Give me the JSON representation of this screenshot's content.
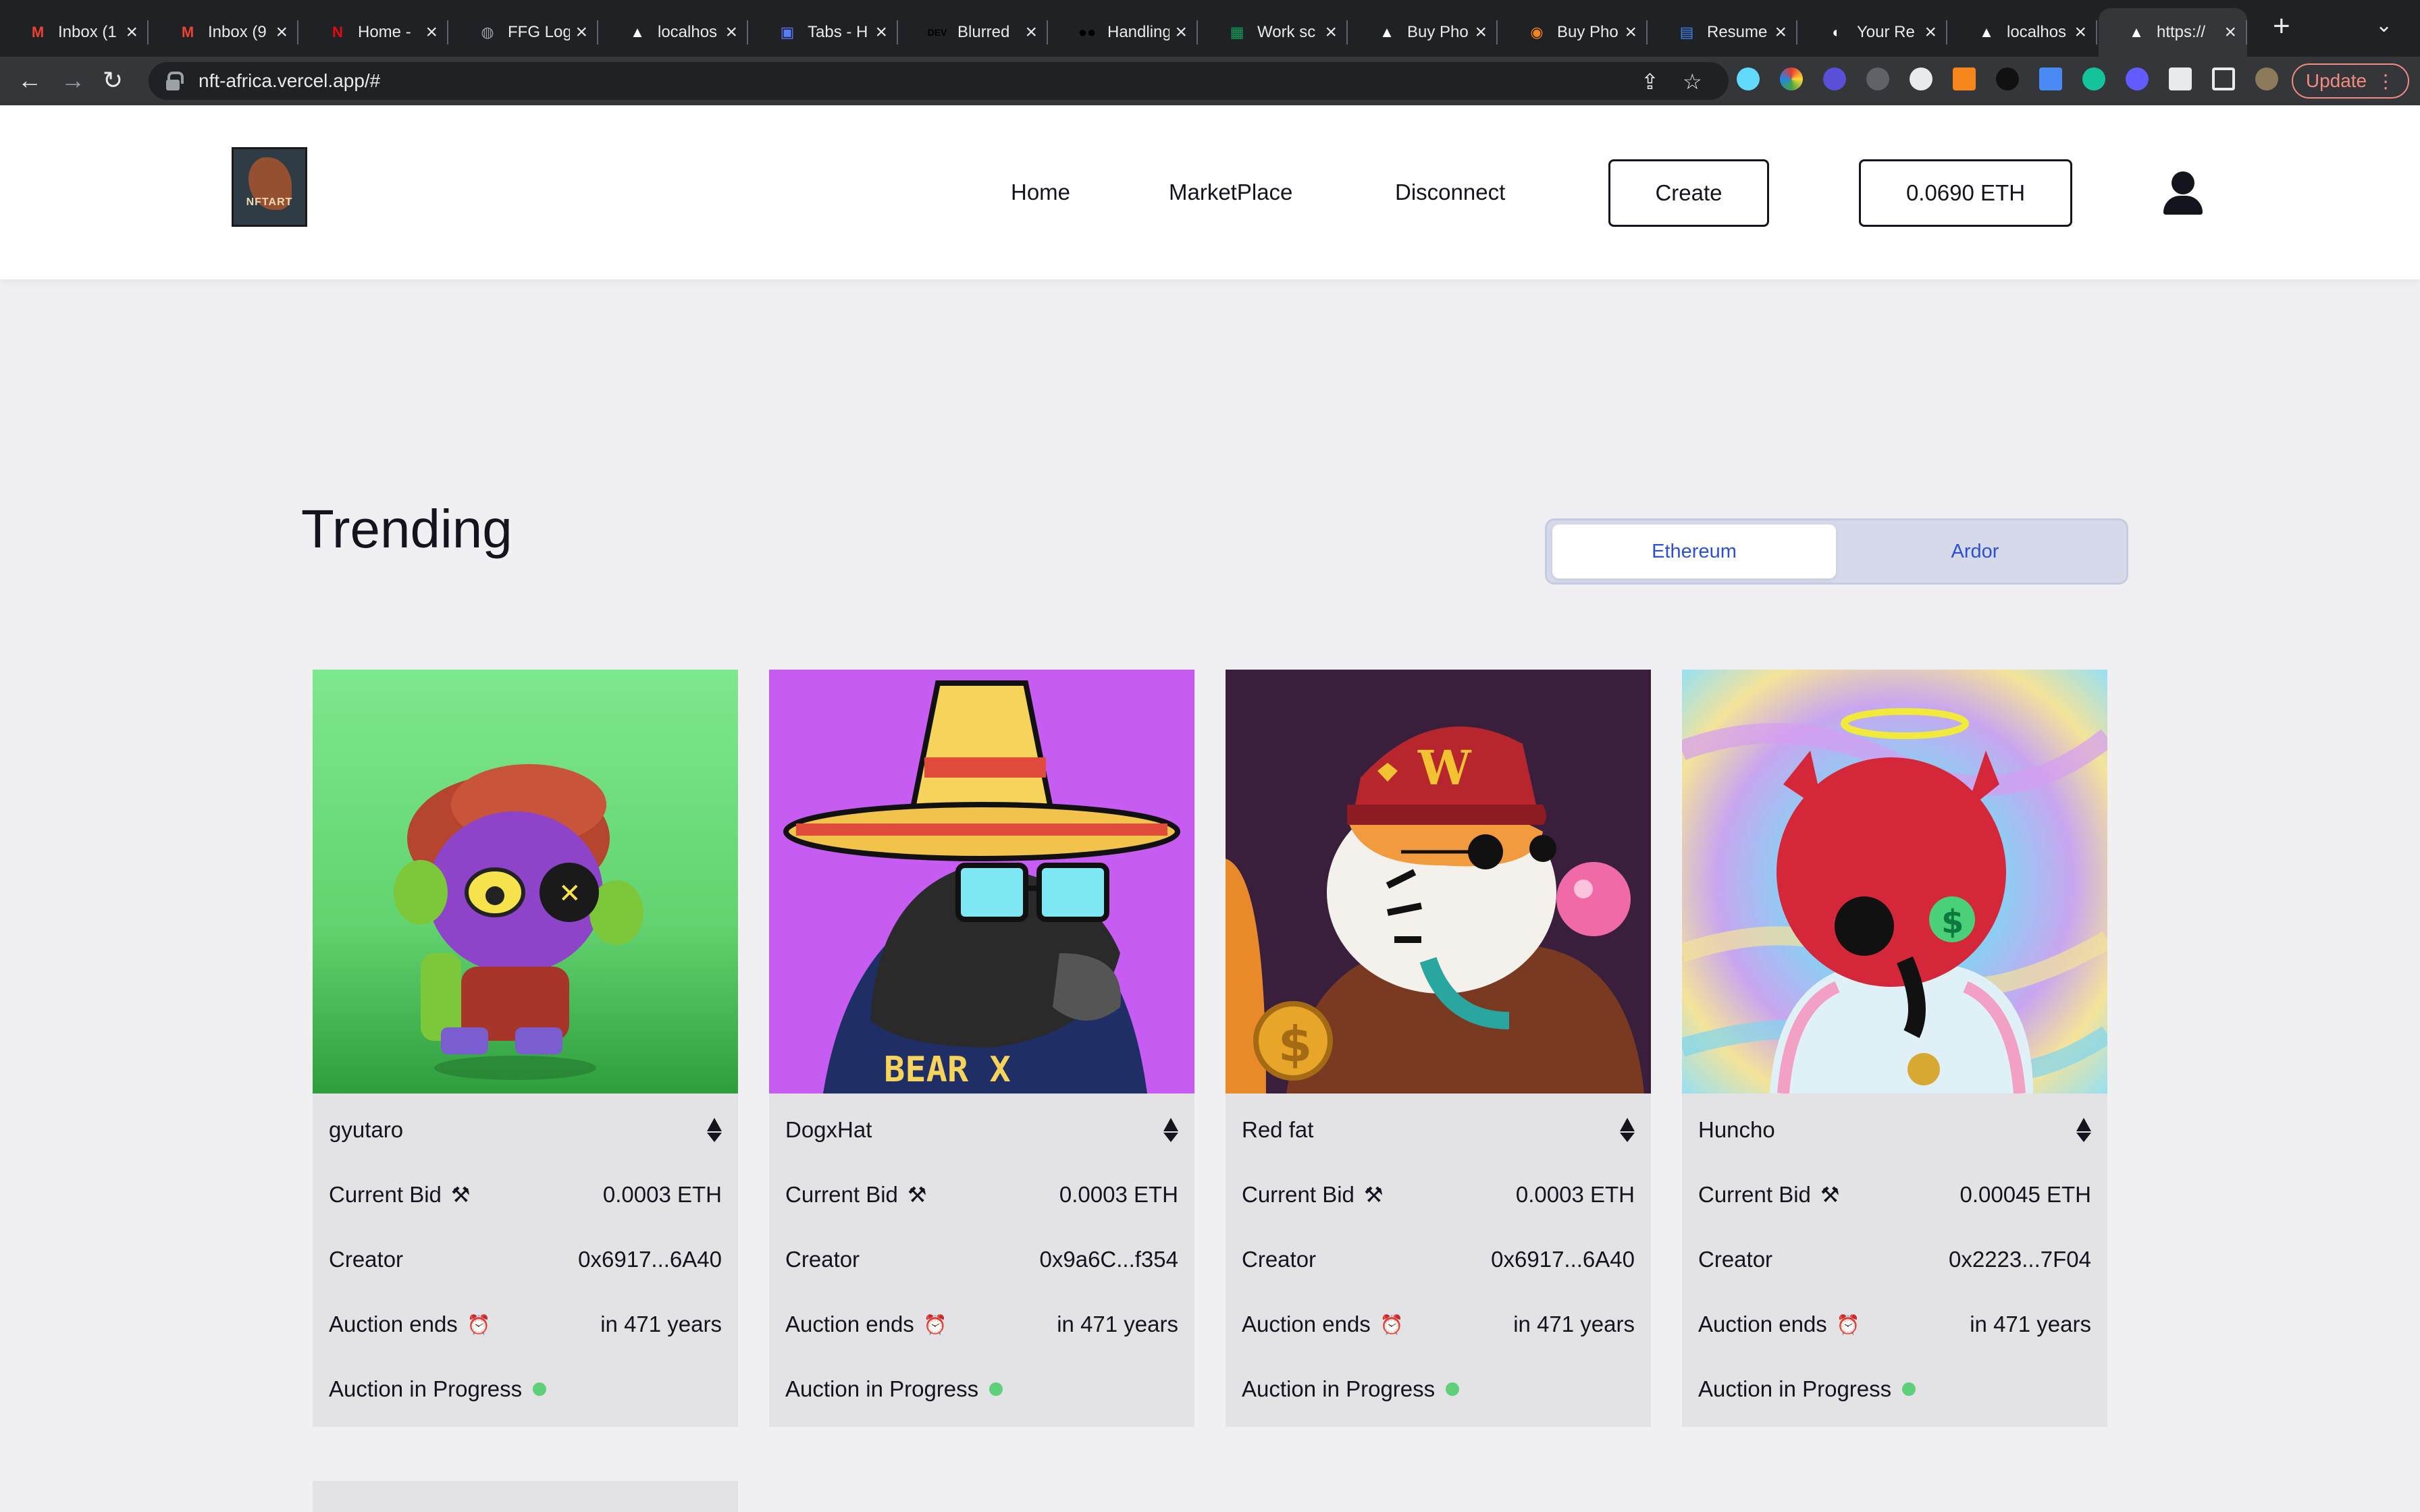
{
  "browser": {
    "tabs": [
      {
        "label": "Inbox (1",
        "favicon": "gmail-icon",
        "color": "#ea4335",
        "glyph": "M"
      },
      {
        "label": "Inbox (9",
        "favicon": "gmail-icon",
        "color": "#ea4335",
        "glyph": "M"
      },
      {
        "label": "Home -",
        "favicon": "netflix-icon",
        "color": "#e50914",
        "glyph": "N"
      },
      {
        "label": "FFG Log",
        "favicon": "globe-icon",
        "color": "#9aa0a6",
        "glyph": "◍"
      },
      {
        "label": "localhos",
        "favicon": "vercel-icon",
        "color": "#ffffff",
        "glyph": "▲"
      },
      {
        "label": "Tabs - H",
        "favicon": "app-icon",
        "color": "#5b7cfa",
        "glyph": "▣"
      },
      {
        "label": "Blurred",
        "favicon": "dev-icon",
        "color": "#000000",
        "glyph": "DEV"
      },
      {
        "label": "Handling",
        "favicon": "medium-icon",
        "color": "#000000",
        "glyph": "●●"
      },
      {
        "label": "Work sc",
        "favicon": "sheets-icon",
        "color": "#0f9d58",
        "glyph": "▦"
      },
      {
        "label": "Buy Pho",
        "favicon": "vercel-icon",
        "color": "#ffffff",
        "glyph": "▲"
      },
      {
        "label": "Buy Pho",
        "favicon": "coin-icon",
        "color": "#f6851b",
        "glyph": "◉"
      },
      {
        "label": "Resume",
        "favicon": "doc-icon",
        "color": "#4285f4",
        "glyph": "▤"
      },
      {
        "label": "Your Re",
        "favicon": "github-icon",
        "color": "#ffffff",
        "glyph": "◐"
      },
      {
        "label": "localhos",
        "favicon": "vercel-icon",
        "color": "#ffffff",
        "glyph": "▲"
      },
      {
        "label": "https://",
        "favicon": "vercel-icon",
        "color": "#ffffff",
        "glyph": "▲"
      }
    ],
    "url": "nft-africa.vercel.app/#",
    "update_label": "Update"
  },
  "header": {
    "logo_text": "NFTART",
    "nav": {
      "home": "Home",
      "marketplace": "MarketPlace",
      "disconnect": "Disconnect"
    },
    "create_label": "Create",
    "balance": "0.0690 ETH"
  },
  "trending": {
    "title": "Trending",
    "chains": [
      "Ethereum",
      "Ardor"
    ],
    "active_chain": "Ethereum"
  },
  "labels": {
    "current_bid": "Current Bid",
    "creator": "Creator",
    "auction_ends": "Auction ends",
    "status": "Auction in Progress"
  },
  "cards": [
    {
      "name": "gyutaro",
      "bid": "0.0003 ETH",
      "creator": "0x6917...6A40",
      "ends": "in 471 years",
      "bg": "#7be08a"
    },
    {
      "name": "DogxHat",
      "bid": "0.0003 ETH",
      "creator": "0x9a6C...f354",
      "ends": "in 471 years",
      "bg": "#c65cf2"
    },
    {
      "name": "Red fat",
      "bid": "0.0003 ETH",
      "creator": "0x6917...6A40",
      "ends": "in 471 years",
      "bg": "#3a1f3d"
    },
    {
      "name": "Huncho",
      "bid": "0.00045 ETH",
      "creator": "0x2223...7F04",
      "ends": "in 471 years",
      "bg": "#9ad0f0"
    }
  ]
}
